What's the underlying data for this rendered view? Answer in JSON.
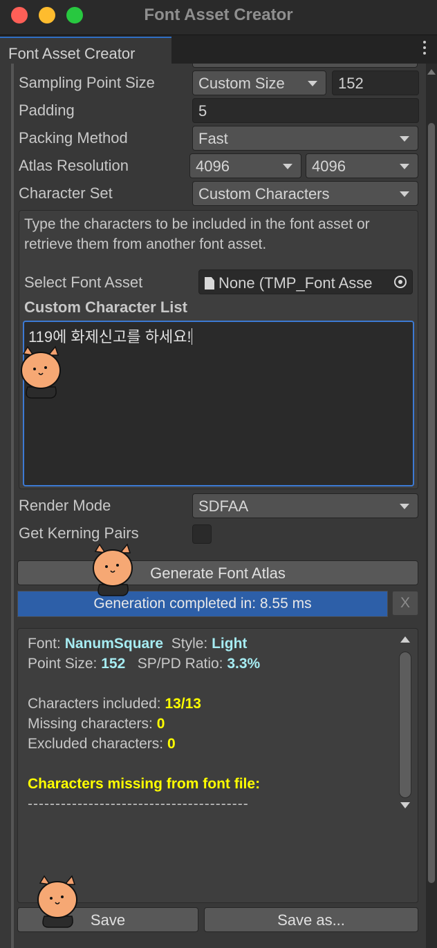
{
  "window": {
    "title": "Font Asset Creator"
  },
  "tab": {
    "label": "Font Asset Creator"
  },
  "settings": {
    "sampling_point_size": {
      "label": "Sampling Point Size",
      "mode": "Custom Size",
      "value": "152"
    },
    "padding": {
      "label": "Padding",
      "value": "5"
    },
    "packing_method": {
      "label": "Packing Method",
      "value": "Fast"
    },
    "atlas_resolution": {
      "label": "Atlas Resolution",
      "width": "4096",
      "height": "4096"
    },
    "character_set": {
      "label": "Character Set",
      "value": "Custom Characters"
    }
  },
  "character_box": {
    "help": "Type the characters to be included in the font asset or retrieve them from another font asset.",
    "select_font_asset_label": "Select Font Asset",
    "select_font_asset_value": "None (TMP_Font Asse",
    "custom_list_label": "Custom Character List",
    "custom_list_value": "119에 화제신고를 하세요!"
  },
  "render": {
    "render_mode_label": "Render Mode",
    "render_mode_value": "SDFAA",
    "kerning_label": "Get Kerning Pairs",
    "kerning_checked": false
  },
  "actions": {
    "generate_label": "Generate Font Atlas",
    "status": "Generation completed in: 8.55 ms",
    "dismiss": "X",
    "save_label": "Save",
    "save_as_label": "Save as..."
  },
  "report": {
    "font_key": "Font: ",
    "font_value": "NanumSquare",
    "style_key": "Style: ",
    "style_value": "Light",
    "point_size_key": "Point Size: ",
    "point_size_value": "152",
    "ratio_key": "SP/PD Ratio: ",
    "ratio_value": "3.3%",
    "included_key": "Characters included: ",
    "included_value": "13/13",
    "missing_key": "Missing characters: ",
    "missing_value": "0",
    "excluded_key": "Excluded characters: ",
    "excluded_value": "0",
    "missing_header": "Characters missing from font file:",
    "separator": "----------------------------------------"
  },
  "colors": {
    "accent": "#2d5fa8",
    "highlight_cyan": "#a6ecf2",
    "highlight_yellow": "#ffff00"
  }
}
